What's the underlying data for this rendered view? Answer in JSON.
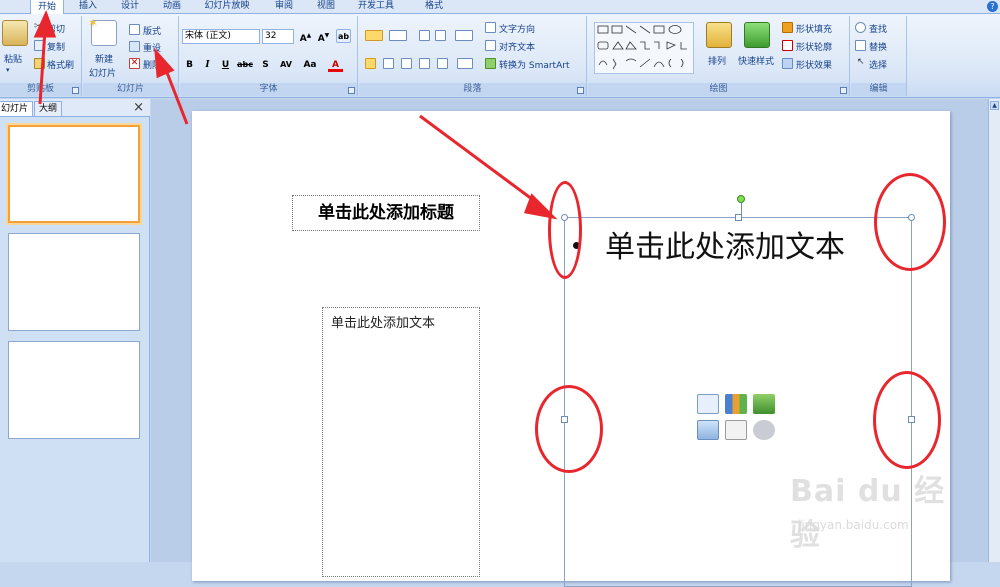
{
  "tabs": [
    "开始",
    "插入",
    "设计",
    "动画",
    "幻灯片放映",
    "审阅",
    "视图",
    "开发工具",
    "格式"
  ],
  "active_tab": "开始",
  "help": "?",
  "clipboard": {
    "paste": "粘贴",
    "cut": "剪切",
    "copy": "复制",
    "format_painter": "格式刷",
    "caption": "剪贴板"
  },
  "slides_group": {
    "new_slide": "新建",
    "new_slide2": "幻灯片",
    "layout": "版式",
    "reset": "重设",
    "delete": "删除",
    "caption": "幻灯片"
  },
  "font_group": {
    "font_name": "宋体 (正文)",
    "font_size": "32",
    "caption": "字体",
    "bold": "B",
    "italic": "I",
    "underline": "U",
    "strike": "abc",
    "shadow": "S",
    "spacing": "AV",
    "case": "Aa",
    "color": "A"
  },
  "paragraph_group": {
    "text_direction": "文字方向",
    "align_text": "对齐文本",
    "smartart": "转换为 SmartArt",
    "caption": "段落"
  },
  "drawing_group": {
    "arrange": "排列",
    "quick_styles": "快速样式",
    "shape_fill": "形状填充",
    "shape_outline": "形状轮廓",
    "shape_effects": "形状效果",
    "caption": "绘图"
  },
  "editing_group": {
    "find": "查找",
    "replace": "替换",
    "select": "选择",
    "caption": "编辑"
  },
  "left_panel": {
    "tab_slides": "幻灯片",
    "tab_outline": "大纲",
    "close": "×"
  },
  "slide": {
    "title_placeholder": "单击此处添加标题",
    "left_text_placeholder": "单击此处添加文本",
    "right_text_placeholder": "单击此处添加文本"
  },
  "watermark": {
    "logo_text": "Bai du 经验",
    "url": "jingyan.baidu.com"
  },
  "colors": {
    "annotation": "#e8262d",
    "ribbon": "#dbe7f7",
    "selection": "#f3a13b"
  }
}
